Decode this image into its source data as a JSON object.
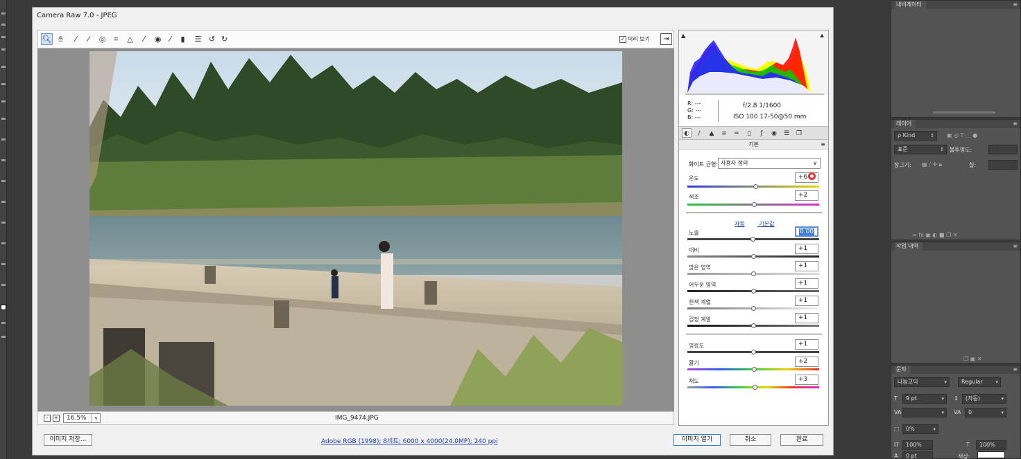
{
  "dialog": {
    "title": "Camera Raw 7.0  -  JPEG",
    "preview_label": "미리 보기",
    "zoom_level": "16.5%",
    "filename": "IMG_9474.JPG",
    "save_button": "이미지 저장...",
    "workflow_link": "Adobe RGB (1998); 8비트; 6000 x 4000(24.0MP); 240 ppi",
    "open_button": "이미지 열기",
    "cancel_button": "취소",
    "done_button": "완료"
  },
  "tools": [
    "zoom-tool",
    "hand-tool",
    "white-balance-tool",
    "color-sampler-tool",
    "target-adjustment-tool",
    "crop-tool",
    "straighten-tool",
    "spot-removal-tool",
    "red-eye-tool",
    "adjustment-brush-tool",
    "graduated-filter-tool",
    "preferences",
    "rotate-ccw",
    "rotate-cw"
  ],
  "info": {
    "rgb_lines": [
      "R: ---",
      "G: ---",
      "B: ---"
    ],
    "exif_line1": "f/2.8   1/1600",
    "exif_line2": "ISO 100   17-50@50 mm"
  },
  "panel": {
    "section_title": "기본",
    "wb_label": "화이트 균형:",
    "wb_value": "사용자 정의",
    "auto_link": "자동",
    "default_link": "기본값",
    "sliders": [
      {
        "label": "온도",
        "value": "+6",
        "position": 0.52
      },
      {
        "label": "색조",
        "value": "+2",
        "position": 0.51
      },
      {
        "label": "노출",
        "value": "0.00",
        "position": 0.5
      },
      {
        "label": "대비",
        "value": "+1",
        "position": 0.505
      },
      {
        "label": "밝은 영역",
        "value": "+1",
        "position": 0.505
      },
      {
        "label": "어두운 영역",
        "value": "+1",
        "position": 0.505
      },
      {
        "label": "흰색 계열",
        "value": "+1",
        "position": 0.505
      },
      {
        "label": "검정 계열",
        "value": "+1",
        "position": 0.505
      },
      {
        "label": "명료도",
        "value": "+1",
        "position": 0.505
      },
      {
        "label": "활기",
        "value": "+2",
        "position": 0.51
      },
      {
        "label": "채도",
        "value": "+3",
        "position": 0.515
      }
    ]
  },
  "ps_panels": {
    "navigator": "내비게이터",
    "layers": {
      "title": "레이어",
      "filter": "ρ Kind",
      "blend": "표준",
      "opacity_label": "불투명도:",
      "lock_label": "잠그기:",
      "fill_label": "칠:"
    },
    "history": "작업 내역",
    "character": {
      "title": "문자",
      "font": "나눔고딕",
      "style": "Regular",
      "size": "9 pt",
      "leading": "(자동)",
      "tracking": "0",
      "scale": "0%",
      "vscale": "100%",
      "hscale": "100%",
      "baseline": "0 pt",
      "color_label": "색상:"
    }
  },
  "colors": {
    "accent": "#3b7ad4",
    "link": "#1a3fa8"
  }
}
